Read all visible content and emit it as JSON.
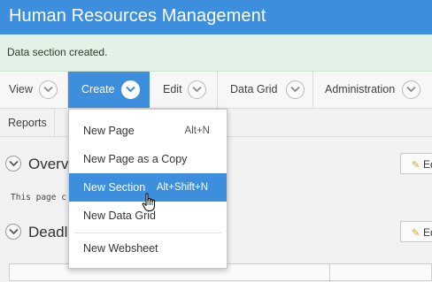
{
  "header": {
    "title": "Human Resources Management"
  },
  "notification": {
    "message": "Data section created."
  },
  "menubar": {
    "items": [
      {
        "label": "View"
      },
      {
        "label": "Create"
      },
      {
        "label": "Edit"
      },
      {
        "label": "Data Grid"
      },
      {
        "label": "Administration"
      }
    ],
    "active": "Create"
  },
  "subbar": {
    "reports_label": "Reports"
  },
  "create_menu": {
    "items": [
      {
        "label": "New Page",
        "shortcut": "Alt+N"
      },
      {
        "label": "New Page as a Copy",
        "shortcut": ""
      },
      {
        "label": "New Section",
        "shortcut": "Alt+Shift+N"
      },
      {
        "label": "New Data Grid",
        "shortcut": ""
      },
      {
        "label": "New Websheet",
        "shortcut": ""
      }
    ],
    "highlighted": "New Section"
  },
  "regions": [
    {
      "title": "Overvi",
      "body": "This page c",
      "edit_label": "Ed"
    },
    {
      "title": "Deadli",
      "edit_label": "Ed"
    }
  ],
  "colors": {
    "accent": "#3d8fde",
    "notice_bg": "#e3f2e6"
  },
  "icons": [
    "chevron-down-icon",
    "collapse-icon",
    "pencil-icon",
    "hand-cursor-icon"
  ]
}
